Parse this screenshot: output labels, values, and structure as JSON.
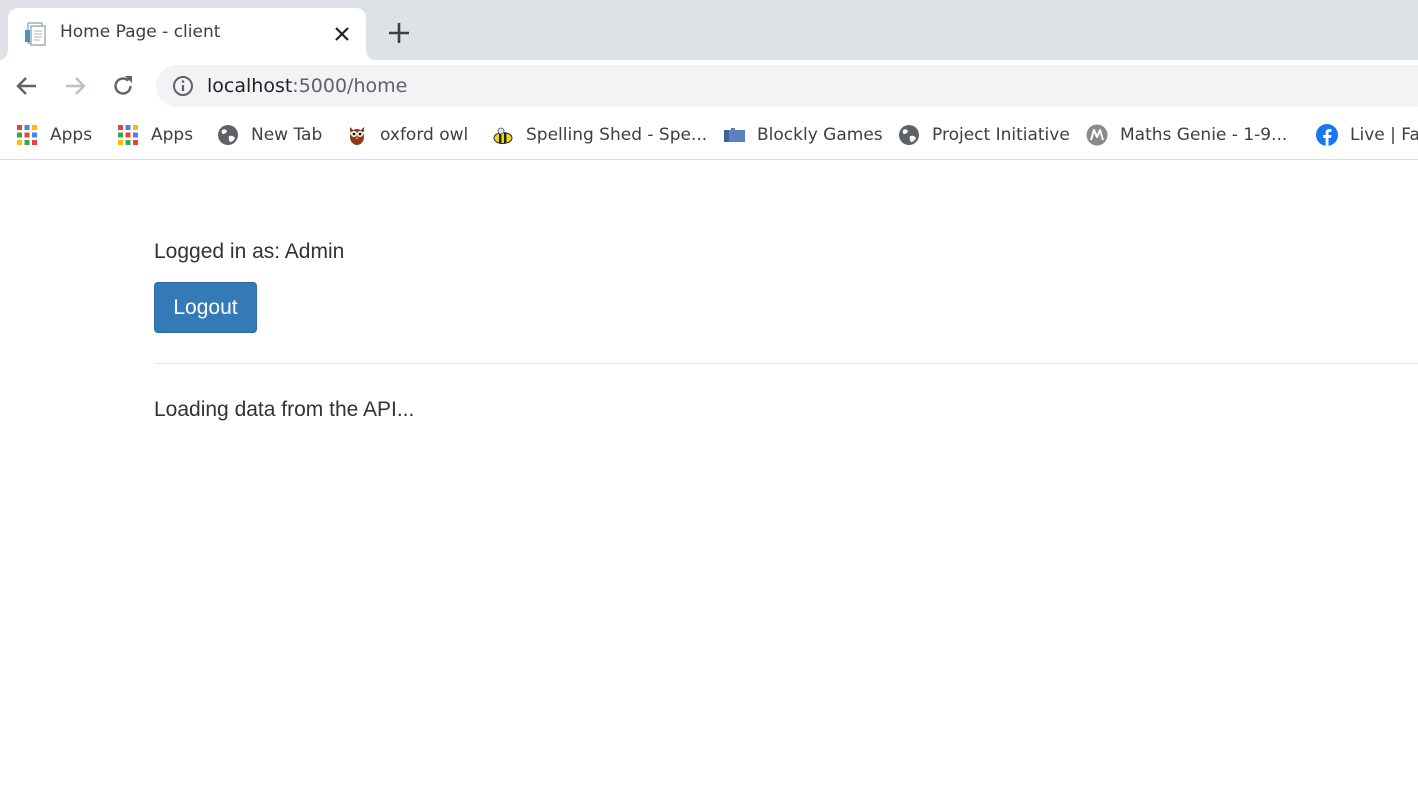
{
  "browser": {
    "tab": {
      "title": "Home Page - client",
      "favicon": "document-icon"
    },
    "omnibox": {
      "host": "localhost",
      "path": ":5000/home",
      "icon": "info-icon"
    },
    "bookmarks": [
      {
        "label": "Apps",
        "icon": "apps-grid-icon"
      },
      {
        "label": "Apps",
        "icon": "apps-grid-icon"
      },
      {
        "label": "New Tab",
        "icon": "globe-icon"
      },
      {
        "label": "oxford owl",
        "icon": "owl-icon"
      },
      {
        "label": "Spelling Shed - Spe...",
        "icon": "bee-icon"
      },
      {
        "label": "Blockly Games",
        "icon": "puzzle-icon"
      },
      {
        "label": "Project Initiative",
        "icon": "globe-icon"
      },
      {
        "label": "Maths Genie - 1-9...",
        "icon": "maths-genie-icon"
      },
      {
        "label": "Live | Fac",
        "icon": "facebook-icon"
      }
    ]
  },
  "page": {
    "logged_in_text": "Logged in as: Admin",
    "logout_label": "Logout",
    "loading_text": "Loading data from the API..."
  },
  "colors": {
    "primary_button": "#337ab7",
    "tabstrip_bg": "#dee1e6",
    "omnibox_bg": "#f1f3f4",
    "text": "#333333"
  }
}
